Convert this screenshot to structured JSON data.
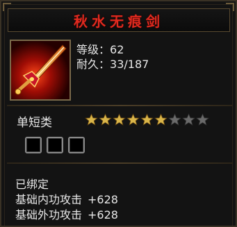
{
  "item": {
    "name": "秋水无痕剑",
    "level_label": "等级：",
    "level_value": "62",
    "durability_label": "耐久：",
    "durability_value": "33/187",
    "type": "单短类",
    "stars_filled": 6,
    "stars_total": 9,
    "slots_count": 3
  },
  "details": {
    "bound": "已绑定",
    "stats": [
      {
        "label": "基础内功攻击",
        "value": "+628"
      },
      {
        "label": "基础外功攻击",
        "value": "+628"
      }
    ]
  },
  "colors": {
    "title": "#e12a1f",
    "star_filled": "#d9b54a",
    "star_empty": "#6a6a6a",
    "text": "#e8e8e8",
    "frame": "#7a6a4a"
  },
  "icons": {
    "weapon": "sword-icon",
    "star": "star-icon",
    "slot": "gem-slot-icon"
  }
}
